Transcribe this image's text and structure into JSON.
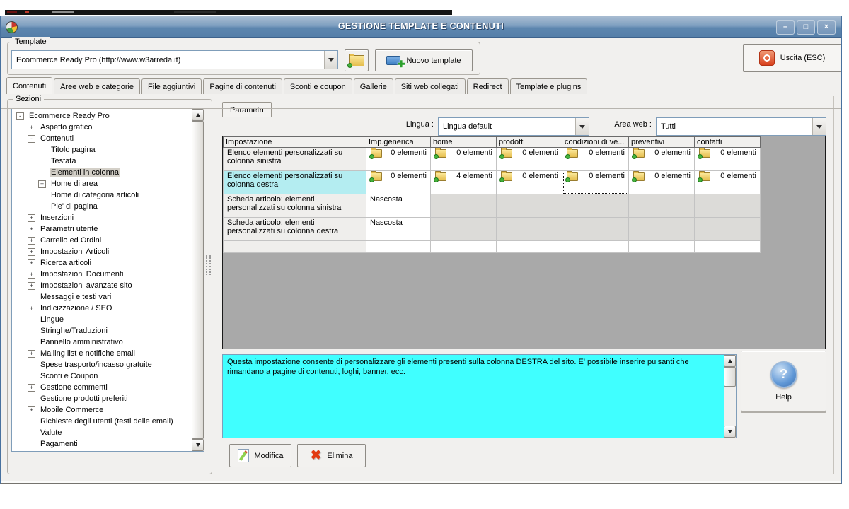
{
  "window": {
    "title": "GESTIONE TEMPLATE E CONTENUTI",
    "controls": {
      "minimize": "–",
      "maximize": "□",
      "close": "×"
    }
  },
  "template_box": {
    "label": "Template",
    "combo_value": "Ecommerce Ready Pro (http://www.w3arreda.it)",
    "new_template_label": "Nuovo template",
    "exit_label": "Uscita (ESC)"
  },
  "tabs": [
    {
      "label": "Contenuti"
    },
    {
      "label": "Aree web e categorie"
    },
    {
      "label": "File aggiuntivi"
    },
    {
      "label": "Pagine di contenuti"
    },
    {
      "label": "Sconti e coupon"
    },
    {
      "label": "Gallerie"
    },
    {
      "label": "Siti web collegati"
    },
    {
      "label": "Redirect"
    },
    {
      "label": "Template e plugins"
    }
  ],
  "sezioni": {
    "label": "Sezioni",
    "items": [
      {
        "label": "Ecommerce Ready Pro",
        "glyph": "-"
      },
      {
        "label": "Aspetto grafico",
        "glyph": "+"
      },
      {
        "label": "Contenuti",
        "glyph": "-"
      },
      {
        "label": "Titolo pagina",
        "glyph": ""
      },
      {
        "label": "Testata",
        "glyph": ""
      },
      {
        "label": "Elementi in colonna",
        "glyph": ""
      },
      {
        "label": "Home di area",
        "glyph": "+"
      },
      {
        "label": "Home di categoria articoli",
        "glyph": ""
      },
      {
        "label": "Pie' di pagina",
        "glyph": ""
      },
      {
        "label": "Inserzioni",
        "glyph": "+"
      },
      {
        "label": "Parametri utente",
        "glyph": "+"
      },
      {
        "label": "Carrello ed Ordini",
        "glyph": "+"
      },
      {
        "label": "Impostazioni Articoli",
        "glyph": "+"
      },
      {
        "label": "Ricerca articoli",
        "glyph": "+"
      },
      {
        "label": "Impostazioni Documenti",
        "glyph": "+"
      },
      {
        "label": "Impostazioni avanzate sito",
        "glyph": "+"
      },
      {
        "label": "Messaggi e testi vari",
        "glyph": ""
      },
      {
        "label": "Indicizzazione / SEO",
        "glyph": "+"
      },
      {
        "label": "Lingue",
        "glyph": ""
      },
      {
        "label": "Stringhe/Traduzioni",
        "glyph": ""
      },
      {
        "label": "Pannello amministrativo",
        "glyph": ""
      },
      {
        "label": "Mailing list e notifiche email",
        "glyph": "+"
      },
      {
        "label": "Spese trasporto/incasso gratuite",
        "glyph": ""
      },
      {
        "label": "Sconti e Coupon",
        "glyph": ""
      },
      {
        "label": "Gestione commenti",
        "glyph": "+"
      },
      {
        "label": "Gestione prodotti preferiti",
        "glyph": ""
      },
      {
        "label": "Mobile Commerce",
        "glyph": "+"
      },
      {
        "label": "Richieste degli utenti (testi delle email)",
        "glyph": ""
      },
      {
        "label": "Valute",
        "glyph": ""
      },
      {
        "label": "Pagamenti",
        "glyph": ""
      }
    ]
  },
  "parametri": {
    "tab_label": "Parametri",
    "lingua_label": "Lingua :",
    "lingua_value": "Lingua default",
    "area_label": "Area web :",
    "area_value": "Tutti"
  },
  "table": {
    "columns": [
      "Impostazione",
      "Imp.generica",
      "home",
      "prodotti",
      "condizioni di ve...",
      "preventivi",
      "contatti"
    ],
    "rows": [
      {
        "label": "Elenco elementi personalizzati su colonna sinistra",
        "cells": [
          "0 elementi",
          "0 elementi",
          "0 elementi",
          "0 elementi",
          "0 elementi",
          "0 elementi"
        ]
      },
      {
        "label": "Elenco elementi personalizzati su colonna destra",
        "cells": [
          "0 elementi",
          "4 elementi",
          "0 elementi",
          "0 elementi",
          "0 elementi",
          "0 elementi"
        ]
      },
      {
        "label": "Scheda articolo: elementi personalizzati su colonna sinistra",
        "cells": [
          "Nascosta",
          "",
          "",
          "",
          "",
          ""
        ]
      },
      {
        "label": "Scheda articolo: elementi personalizzati su colonna destra",
        "cells": [
          "Nascosta",
          "",
          "",
          "",
          "",
          ""
        ]
      },
      {
        "label": "",
        "cells": [
          "",
          "",
          "",
          "",
          "",
          ""
        ]
      }
    ]
  },
  "description": {
    "text": "Questa impostazione consente di personalizzare gli elementi presenti sulla colonna DESTRA del sito. E' possibile inserire pulsanti che rimandano a pagine di contenuti, loghi, banner, ecc."
  },
  "buttons": {
    "modifica": "Modifica",
    "elimina": "Elimina",
    "help": "Help"
  },
  "colors": {
    "titlebar_top": "#a8bcd2",
    "titlebar_bottom": "#547ea8",
    "selection_cyan": "#b4edf1",
    "description_bg": "#40ffff",
    "grid_empty_gray": "#a9a9a9"
  }
}
